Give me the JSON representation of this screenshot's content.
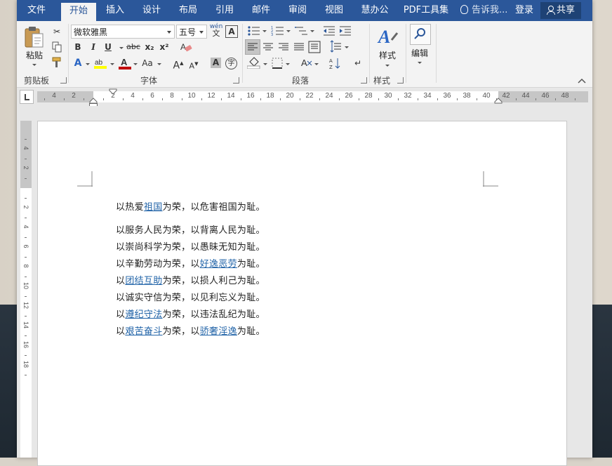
{
  "tabs": [
    "文件",
    "开始",
    "插入",
    "设计",
    "布局",
    "引用",
    "邮件",
    "审阅",
    "视图",
    "慧办公",
    "PDF工具集"
  ],
  "active_tab": "开始",
  "tell_me": "告诉我...",
  "login": "登录",
  "share": "共享",
  "ribbon": {
    "clipboard": {
      "paste": "粘贴",
      "label": "剪贴板"
    },
    "font": {
      "name": "微软雅黑",
      "size": "五号",
      "label": "字体",
      "bold": "B",
      "italic": "I",
      "underline": "U",
      "strike": "abc",
      "sub": "x₂",
      "sup": "x²",
      "grow": "A",
      "shrink": "A",
      "case": "Aa"
    },
    "paragraph": {
      "label": "段落"
    },
    "styles": {
      "button": "样式",
      "label": "样式"
    },
    "editing": {
      "button": "编辑"
    }
  },
  "ruler": {
    "h_left": [
      "4",
      "2"
    ],
    "h_numbers": [
      "2",
      "4",
      "6",
      "8",
      "10",
      "12",
      "14",
      "16",
      "18",
      "20",
      "22",
      "24",
      "26",
      "28",
      "30",
      "32",
      "34",
      "36",
      "38",
      "40",
      "42",
      "44",
      "46",
      "48"
    ],
    "v_top": [
      "4",
      "2"
    ],
    "v_numbers": [
      "2",
      "4",
      "6",
      "8",
      "10",
      "12",
      "14",
      "16",
      "18"
    ]
  },
  "document": {
    "lines": [
      [
        {
          "t": "以热爱"
        },
        {
          "t": "祖国",
          "link": true
        },
        {
          "t": "为荣，以危害祖国为耻。"
        }
      ],
      [
        {
          "t": "以服务人民为荣，以背离人民为耻。"
        }
      ],
      [
        {
          "t": "以崇尚科学为荣，以愚昧无知为耻。"
        }
      ],
      [
        {
          "t": "以辛勤劳动为荣，以"
        },
        {
          "t": "好逸恶劳",
          "link": true
        },
        {
          "t": "为耻。"
        }
      ],
      [
        {
          "t": "以"
        },
        {
          "t": "团结互助",
          "link": true
        },
        {
          "t": "为荣，以损人利己为耻。"
        }
      ],
      [
        {
          "t": "以诚实守信为荣，以见利忘义为耻。"
        }
      ],
      [
        {
          "t": "以"
        },
        {
          "t": "遵纪守法",
          "link": true
        },
        {
          "t": "为荣，以违法乱纪为耻。"
        }
      ],
      [
        {
          "t": "以"
        },
        {
          "t": "艰苦奋斗",
          "link": true
        },
        {
          "t": "为荣，以"
        },
        {
          "t": "骄奢淫逸",
          "link": true
        },
        {
          "t": "为耻。"
        }
      ]
    ]
  },
  "colors": {
    "brand": "#2b579a",
    "link": "#2264a8"
  }
}
